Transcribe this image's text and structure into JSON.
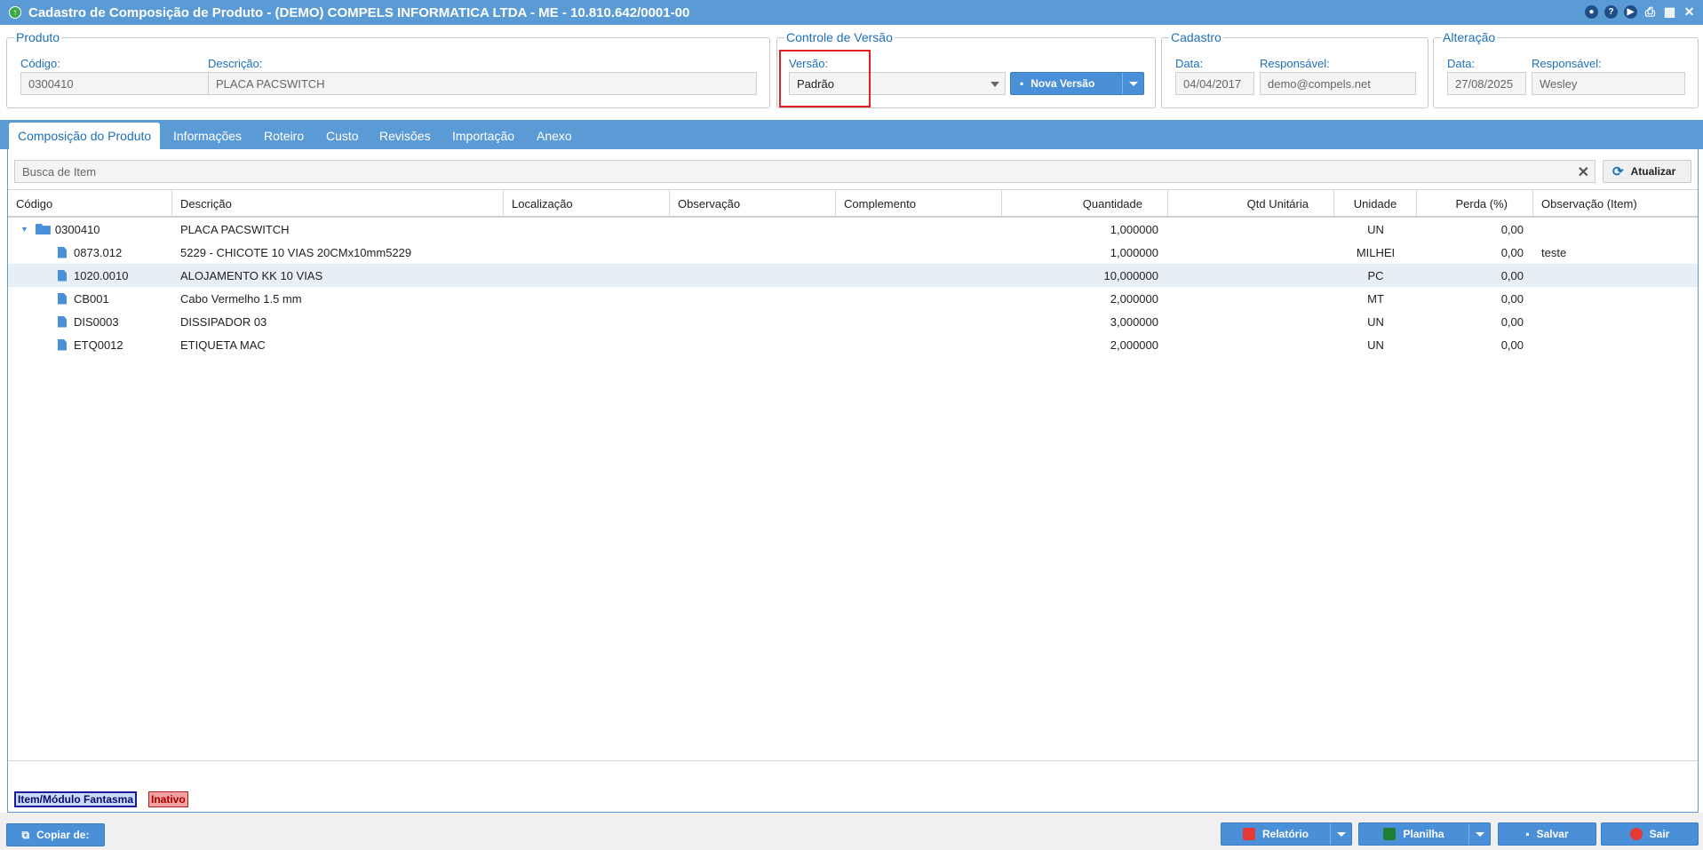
{
  "window": {
    "title": "Cadastro de Composição de Produto - (DEMO) COMPELS INFORMATICA LTDA - ME - 10.810.642/0001-00"
  },
  "produto": {
    "legend": "Produto",
    "codigo_label": "Código:",
    "codigo_value": "0300410",
    "descricao_label": "Descrição:",
    "descricao_value": "PLACA PACSWITCH"
  },
  "versao": {
    "legend": "Controle de Versão",
    "versao_label": "Versão:",
    "versao_value": "Padrão",
    "nova_versao_label": "Nova Versão"
  },
  "cadastro": {
    "legend": "Cadastro",
    "data_label": "Data:",
    "data_value": "04/04/2017",
    "responsavel_label": "Responsável:",
    "responsavel_value": "demo@compels.net"
  },
  "alteracao": {
    "legend": "Alteração",
    "data_label": "Data:",
    "data_value": "27/08/2025",
    "responsavel_label": "Responsável:",
    "responsavel_value": "Wesley"
  },
  "tabs": [
    {
      "label": "Composição do Produto"
    },
    {
      "label": "Informações"
    },
    {
      "label": "Roteiro"
    },
    {
      "label": "Custo"
    },
    {
      "label": "Revisões"
    },
    {
      "label": "Importação"
    },
    {
      "label": "Anexo"
    }
  ],
  "search": {
    "placeholder": "Busca de Item",
    "refresh_label": "Atualizar"
  },
  "grid": {
    "columns": [
      "Código",
      "Descrição",
      "Localização",
      "Observação",
      "Complemento",
      "Quantidade",
      "Qtd Unitária",
      "Unidade",
      "Perda (%)",
      "Observação (Item)"
    ],
    "root": {
      "codigo": "0300410",
      "descricao": "PLACA PACSWITCH",
      "quantidade": "1,000000",
      "unidade": "UN",
      "perda": "0,00",
      "obs_item": ""
    },
    "rows": [
      {
        "codigo": "0873.012",
        "descricao": "5229 - CHICOTE 10 VIAS 20CMx10mm5229",
        "quantidade": "1,000000",
        "unidade": "MILHEI",
        "perda": "0,00",
        "obs_item": "teste"
      },
      {
        "codigo": "1020.0010",
        "descricao": "ALOJAMENTO KK 10 VIAS",
        "quantidade": "10,000000",
        "unidade": "PC",
        "perda": "0,00",
        "obs_item": ""
      },
      {
        "codigo": "CB001",
        "descricao": "Cabo Vermelho 1.5 mm",
        "quantidade": "2,000000",
        "unidade": "MT",
        "perda": "0,00",
        "obs_item": ""
      },
      {
        "codigo": "DIS0003",
        "descricao": "DISSIPADOR 03",
        "quantidade": "3,000000",
        "unidade": "UN",
        "perda": "0,00",
        "obs_item": ""
      },
      {
        "codigo": "ETQ0012",
        "descricao": "ETIQUETA MAC",
        "quantidade": "2,000000",
        "unidade": "UN",
        "perda": "0,00",
        "obs_item": ""
      }
    ]
  },
  "legend": {
    "fantasma": "Item/Módulo Fantasma",
    "inativo": "Inativo"
  },
  "footer": {
    "copiar_label": "Copiar de:",
    "relatorio_label": "Relatório",
    "planilha_label": "Planilha",
    "salvar_label": "Salvar",
    "sair_label": "Sair"
  },
  "colors": {
    "accent": "#5b9bd5",
    "button": "#4a90d9",
    "label": "#1f6fb8",
    "highlight": "#e02020"
  }
}
